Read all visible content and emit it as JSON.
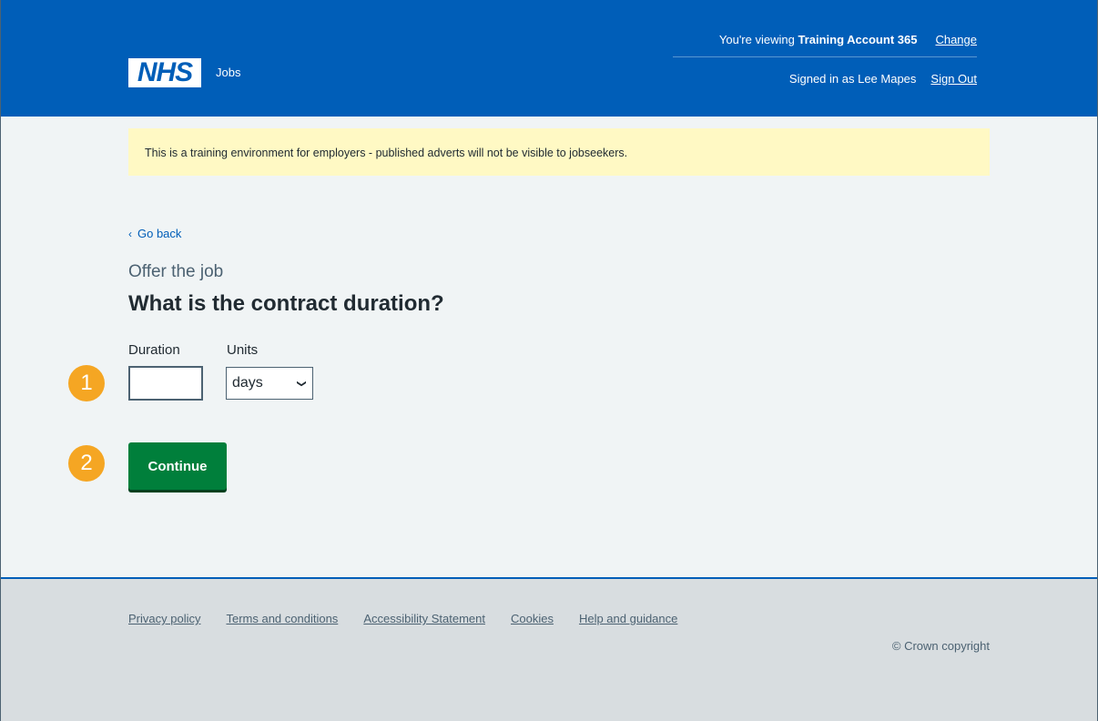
{
  "header": {
    "logo_text": "NHS",
    "service_name": "Jobs",
    "viewing_prefix": "You're viewing ",
    "account_name": "Training Account 365",
    "change_link": "Change",
    "signed_in_text": "Signed in as Lee Mapes",
    "sign_out_link": "Sign Out"
  },
  "banner": {
    "text": "This is a training environment for employers - published adverts will not be visible to jobseekers."
  },
  "nav": {
    "go_back": "Go back"
  },
  "page": {
    "caption": "Offer the job",
    "title": "What is the contract duration?"
  },
  "form": {
    "duration_label": "Duration",
    "duration_value": "",
    "units_label": "Units",
    "units_selected": "days",
    "continue_label": "Continue"
  },
  "markers": [
    "1",
    "2"
  ],
  "footer": {
    "links": [
      "Privacy policy",
      "Terms and conditions",
      "Accessibility Statement",
      "Cookies",
      "Help and guidance"
    ],
    "copyright": "© Crown copyright"
  },
  "colors": {
    "nhs_blue": "#005eb8",
    "button_green": "#007f3b",
    "marker_orange": "#f5a623",
    "banner_yellow": "#fff9c4"
  }
}
